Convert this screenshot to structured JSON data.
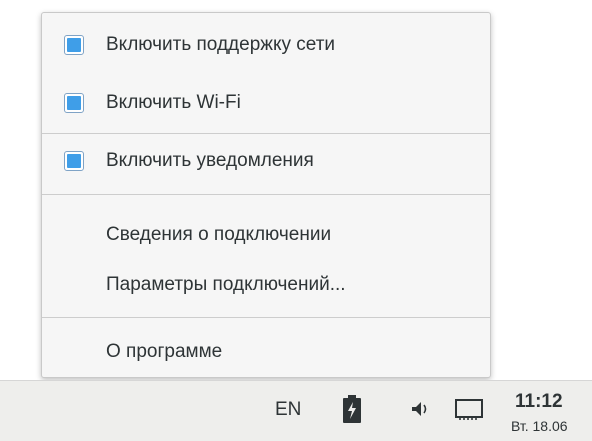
{
  "menu": {
    "items": [
      {
        "label": "Включить поддержку сети",
        "checked": true
      },
      {
        "label": "Включить Wi-Fi",
        "checked": true
      },
      {
        "label": "Включить уведомления",
        "checked": true
      },
      {
        "label": "Сведения о подключении"
      },
      {
        "label": "Параметры подключений..."
      },
      {
        "label": "О программе"
      }
    ]
  },
  "panel": {
    "keyboard_layout": "EN",
    "icons": [
      "battery-charging-icon",
      "speaker-icon",
      "network-wired-icon"
    ],
    "clock": {
      "time": "11:12",
      "date": "Вт. 18.06"
    }
  },
  "colors": {
    "checkbox_fill": "#3f9ee8",
    "menu_background": "#f6f6f6",
    "panel_background": "#eeeeec"
  }
}
